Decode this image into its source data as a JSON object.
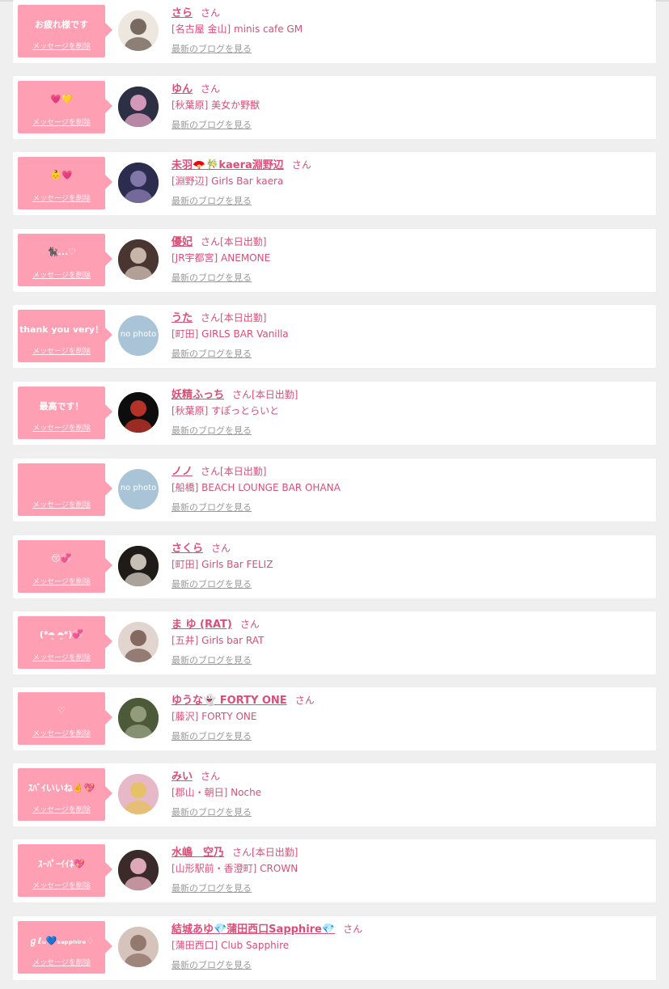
{
  "messages": [
    {
      "bubble": "お疲れ様です",
      "delete_label": "メッセージを削除",
      "name": "さら",
      "suffix": "さん",
      "status": "",
      "shop": "[名古屋 金山] minis cafe GM",
      "blog_label": "最新のブログを見る",
      "avatar": {
        "kind": "photo",
        "bg": "#eee7df",
        "fg": "#6b5c53"
      }
    },
    {
      "bubble": "💗💛",
      "delete_label": "メッセージを削除",
      "name": "ゆん",
      "suffix": "さん",
      "status": "",
      "shop": "[秋葉原] 美女か野獣",
      "blog_label": "最新のブログを見る",
      "avatar": {
        "kind": "photo",
        "bg": "#2d2f44",
        "fg": "#e7a5c7"
      }
    },
    {
      "bubble": "👶💗",
      "delete_label": "メッセージを削除",
      "name": "未羽🪭🎋kaera淵野辺",
      "suffix": "さん",
      "status": "",
      "shop": "[淵野辺] Girls Bar kaera",
      "blog_label": "最新のブログを見る",
      "avatar": {
        "kind": "photo",
        "bg": "#2c2c4f",
        "fg": "#8b7fb2"
      }
    },
    {
      "bubble": "🐈‍⬛...♡",
      "delete_label": "メッセージを削除",
      "name": "優妃",
      "suffix": "さん",
      "status": "[本日出勤]",
      "shop": "[JR宇都宮] ANEMONE",
      "blog_label": "最新のブログを見る",
      "avatar": {
        "kind": "photo",
        "bg": "#4a3631",
        "fg": "#d6c3b8"
      }
    },
    {
      "bubble": "thank you very！",
      "delete_label": "メッセージを削除",
      "name": "うた",
      "suffix": "さん",
      "status": "[本日出勤]",
      "shop": "[町田] GIRLS BAR Vanilla",
      "blog_label": "最新のブログを見る",
      "avatar": {
        "kind": "nophoto",
        "text": "no photo",
        "bg": "#a8c4d6"
      }
    },
    {
      "bubble": "最高です！",
      "delete_label": "メッセージを削除",
      "name": "妖精ふっち",
      "suffix": "さん",
      "status": "[本日出勤]",
      "shop": "[秋葉原] すぽっとらいと",
      "blog_label": "最新のブログを見る",
      "avatar": {
        "kind": "photo",
        "bg": "#0d0d0d",
        "fg": "#c9362b"
      }
    },
    {
      "bubble": "",
      "delete_label": "メッセージを削除",
      "name": "ノノ",
      "suffix": "さん",
      "status": "[本日出勤]",
      "shop": "[船橋] BEACH LOUNGE BAR OHANA",
      "blog_label": "最新のブログを見る",
      "avatar": {
        "kind": "nophoto",
        "text": "no photo",
        "bg": "#a8c4d6"
      }
    },
    {
      "bubble": "😚💞",
      "delete_label": "メッセージを削除",
      "name": "さくら",
      "suffix": "さん",
      "status": "",
      "shop": "[町田] Girls Bar FELIZ",
      "blog_label": "最新のブログを見る",
      "avatar": {
        "kind": "photo",
        "bg": "#1e1b18",
        "fg": "#d8d1c7"
      }
    },
    {
      "bubble": "(*ᴖ̴̤ ᴖ̴̤*)💞",
      "delete_label": "メッセージを削除",
      "name": "ま ゆ (RAT)",
      "suffix": "さん",
      "status": "",
      "shop": "[五井] Girls bar RAT",
      "blog_label": "最新のブログを見る",
      "avatar": {
        "kind": "photo",
        "bg": "#e2d4cf",
        "fg": "#7a5d54"
      }
    },
    {
      "bubble": "♡",
      "delete_label": "メッセージを削除",
      "name": "ゆうな👻 FORTY ONE",
      "suffix": "さん",
      "status": "",
      "shop": "[藤沢] FORTY ONE",
      "blog_label": "最新のブログを見る",
      "avatar": {
        "kind": "photo",
        "bg": "#4d5a3a",
        "fg": "#9aa385"
      }
    },
    {
      "bubble": "ｽﾊﾞｲいいね🤞💖",
      "delete_label": "メッセージを削除",
      "name": "みい",
      "suffix": "さん",
      "status": "",
      "shop": "[郡山・朝日] Noche",
      "blog_label": "最新のブログを見る",
      "avatar": {
        "kind": "photo",
        "bg": "#e7b8c7",
        "fg": "#e4c25d"
      }
    },
    {
      "bubble": "ｽｰﾊﾟｰｲｲﾈ💖",
      "delete_label": "メッセージを削除",
      "name": "水嶋　空乃",
      "suffix": "さん",
      "status": "[本日出勤]",
      "shop": "[山形駅前・香澄町] CROWN",
      "blog_label": "最新のブログを見る",
      "avatar": {
        "kind": "photo",
        "bg": "#3b2a2a",
        "fg": "#f0b6c7"
      }
    },
    {
      "bubble": "ℊℓᵤ💙ₛₐₚₚₕᵢᵣₑ♢",
      "delete_label": "メッセージを削除",
      "name": "結城あゆ💎蒲田西口Sapphire💎",
      "suffix": "さん",
      "status": "",
      "shop": "[蒲田西口] Club Sapphire",
      "blog_label": "最新のブログを見る",
      "avatar": {
        "kind": "photo",
        "bg": "#d6c3bb",
        "fg": "#8c7065"
      }
    }
  ]
}
